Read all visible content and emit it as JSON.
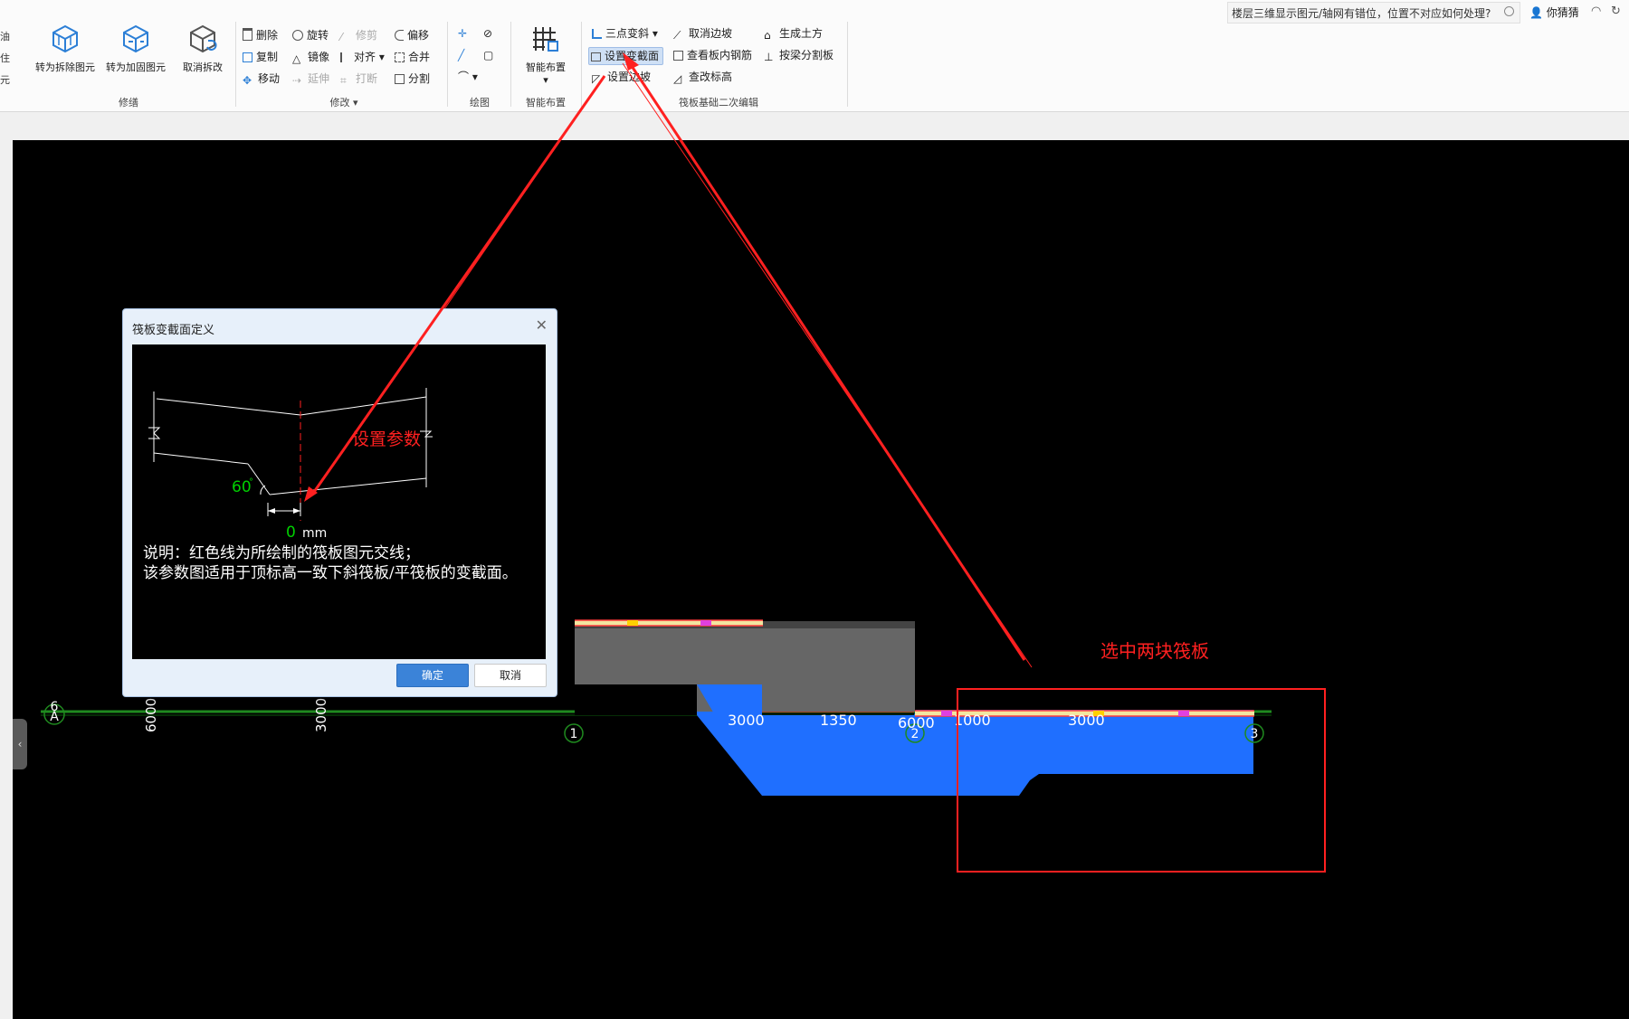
{
  "topbar": {
    "search_text": "楼层三维显示图元/轴网有错位，位置不对应如何处理?",
    "user_label": "你猜猜"
  },
  "ribbon": {
    "left_edge": [
      "油",
      "住",
      "元"
    ],
    "groups": [
      {
        "title": "修缮",
        "buttons": [
          "转为拆除图元",
          "转为加固图元",
          "取消拆改"
        ]
      },
      {
        "title": "修改",
        "buttons": [
          {
            "label": "删除",
            "enabled": true
          },
          {
            "label": "旋转",
            "enabled": true
          },
          {
            "label": "修剪",
            "enabled": false
          },
          {
            "label": "偏移",
            "enabled": true
          },
          {
            "label": "复制",
            "enabled": true
          },
          {
            "label": "镜像",
            "enabled": true
          },
          {
            "label": "对齐",
            "enabled": true
          },
          {
            "label": "合并",
            "enabled": true
          },
          {
            "label": "移动",
            "enabled": true
          },
          {
            "label": "延伸",
            "enabled": false
          },
          {
            "label": "打断",
            "enabled": false
          },
          {
            "label": "分割",
            "enabled": true
          }
        ]
      },
      {
        "title": "绘图"
      },
      {
        "title": "智能布置",
        "buttons": [
          "智能布置"
        ]
      },
      {
        "title": "筏板基础二次编辑",
        "buttons": [
          "三点变斜",
          "取消边坡",
          "生成土方",
          "设置变截面",
          "查看板内钢筋",
          "按梁分割板",
          "设置边坡",
          "查改标高"
        ]
      }
    ]
  },
  "dialog": {
    "title": "筏板变截面定义",
    "angle_value": "60",
    "angle_unit": "°",
    "width_value": "0",
    "width_unit": "mm",
    "note_line1": "说明：红色线为所绘制的筏板图元交线；",
    "note_line2": "该参数图适用于顶标高一致下斜筏板/平筏板的变截面。",
    "ok_label": "确定",
    "cancel_label": "取消"
  },
  "annotations": {
    "set_params": "设置参数",
    "select_two": "选中两块筏板"
  },
  "drawing": {
    "axis_labels": [
      "6",
      "A",
      "1",
      "2",
      "3"
    ],
    "dimensions": [
      "6000",
      "3000",
      "3000",
      "1350",
      "6000",
      "1000",
      "3000"
    ],
    "colors": {
      "slab": "#1f6fff",
      "section": "#666666",
      "annotation": "#ff2020",
      "dimension": "#ffffff"
    }
  }
}
